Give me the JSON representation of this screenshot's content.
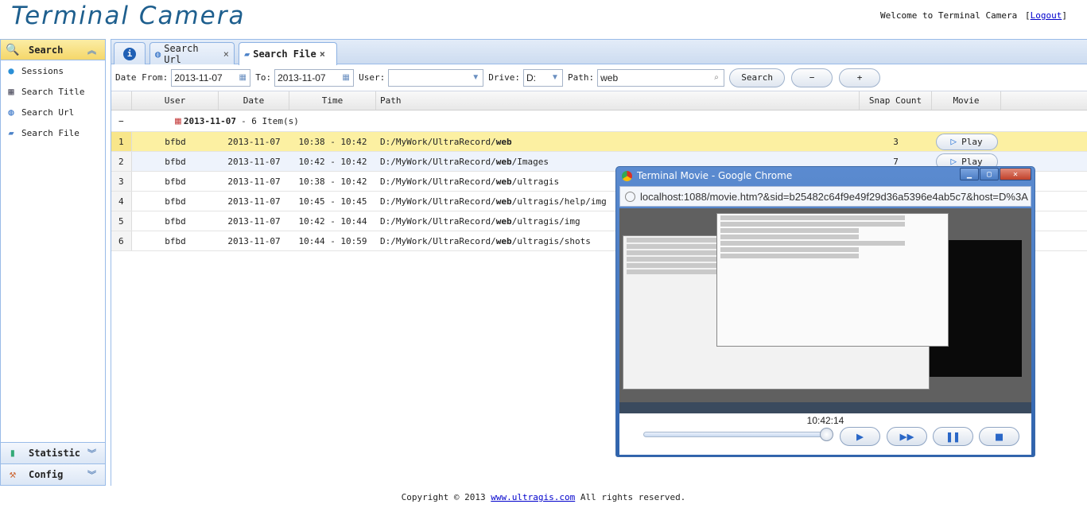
{
  "app": {
    "title": "Terminal Camera",
    "welcome": "Welcome to Terminal Camera",
    "logout_open": "[",
    "logout_label": "Logout",
    "logout_close": "]"
  },
  "sidebar": {
    "search_header": "Search",
    "items": [
      {
        "label": "Sessions",
        "icon": "sessions-icon"
      },
      {
        "label": "Search Title",
        "icon": "window-icon"
      },
      {
        "label": "Search Url",
        "icon": "globe-icon"
      },
      {
        "label": "Search File",
        "icon": "folder-icon"
      }
    ],
    "statistic_header": "Statistic",
    "config_header": "Config"
  },
  "tabs": [
    {
      "label": "",
      "icon": "info-icon"
    },
    {
      "label": "Search Url",
      "icon": "globe-icon",
      "close": "×"
    },
    {
      "label": "Search File",
      "icon": "folder-icon",
      "close": "×",
      "active": true
    }
  ],
  "toolbar": {
    "date_from_label": "Date From:",
    "date_from": "2013-11-07",
    "to_label": "To:",
    "date_to": "2013-11-07",
    "user_label": "User:",
    "user_value": "",
    "drive_label": "Drive:",
    "drive_value": "D:",
    "path_label": "Path:",
    "path_value": "web",
    "search_button": "Search",
    "minus_button": "−",
    "plus_button": "+"
  },
  "grid": {
    "columns": [
      "User",
      "Date",
      "Time",
      "Path",
      "Snap Count",
      "Movie"
    ],
    "group_toggle": "−",
    "group_date": "2013-11-07",
    "group_count": "- 6 Item(s)",
    "play_label": "Play",
    "rows": [
      {
        "n": "1",
        "user": "bfbd",
        "date": "2013-11-07",
        "time": "10:38 - 10:42",
        "path_pre": "D:/MyWork/UltraRecord/",
        "path_bold": "web",
        "path_post": "",
        "snap": "3"
      },
      {
        "n": "2",
        "user": "bfbd",
        "date": "2013-11-07",
        "time": "10:42 - 10:42",
        "path_pre": "D:/MyWork/UltraRecord/",
        "path_bold": "web",
        "path_post": "/Images",
        "snap": "7"
      },
      {
        "n": "3",
        "user": "bfbd",
        "date": "2013-11-07",
        "time": "10:38 - 10:42",
        "path_pre": "D:/MyWork/UltraRecord/",
        "path_bold": "web",
        "path_post": "/ultragis",
        "snap": ""
      },
      {
        "n": "4",
        "user": "bfbd",
        "date": "2013-11-07",
        "time": "10:45 - 10:45",
        "path_pre": "D:/MyWork/UltraRecord/",
        "path_bold": "web",
        "path_post": "/ultragis/help/img",
        "snap": ""
      },
      {
        "n": "5",
        "user": "bfbd",
        "date": "2013-11-07",
        "time": "10:42 - 10:44",
        "path_pre": "D:/MyWork/UltraRecord/",
        "path_bold": "web",
        "path_post": "/ultragis/img",
        "snap": ""
      },
      {
        "n": "6",
        "user": "bfbd",
        "date": "2013-11-07",
        "time": "10:44 - 10:59",
        "path_pre": "D:/MyWork/UltraRecord/",
        "path_bold": "web",
        "path_post": "/ultragis/shots",
        "snap": ""
      }
    ]
  },
  "popup": {
    "title": "Terminal Movie - Google Chrome",
    "url": "localhost:1088/movie.htm?&sid=b25482c64f9e49f29d36a5396e4ab5c7&host=D%3A",
    "time": "10:42:14",
    "progress": 0.98
  },
  "footer": {
    "pre": "Copyright © 2013 ",
    "link": "www.ultragis.com",
    "post": " All rights reserved."
  },
  "colors": {
    "accent": "#1e5f8e",
    "border": "#99bbe8",
    "selected_row": "#fcf0a2"
  }
}
